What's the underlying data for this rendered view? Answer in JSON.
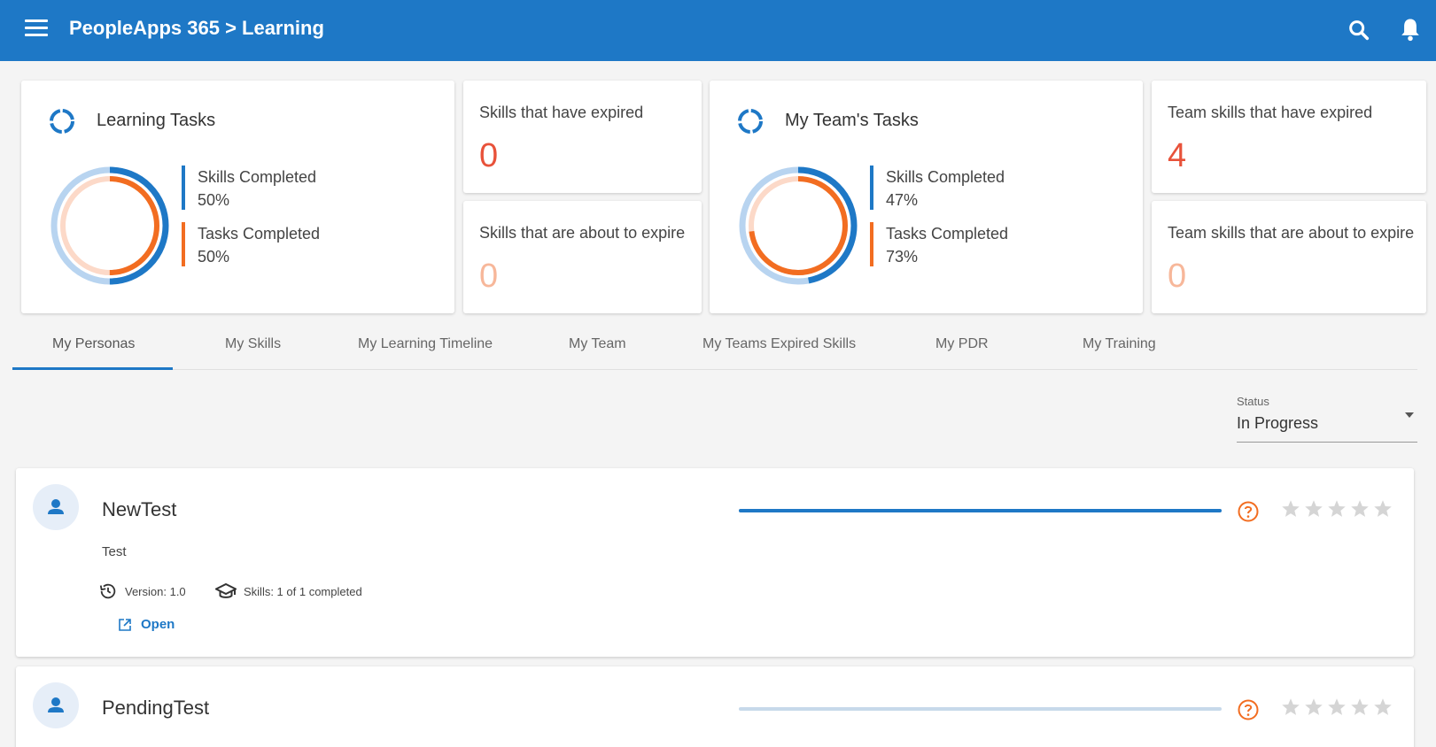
{
  "header": {
    "title": "PeopleApps 365 > Learning"
  },
  "learning_tasks": {
    "title": "Learning Tasks",
    "skills_label": "Skills Completed",
    "skills_value": "50%",
    "skills_fraction": 0.5,
    "tasks_label": "Tasks Completed",
    "tasks_value": "50%",
    "tasks_fraction": 0.5
  },
  "skills_expired": {
    "label": "Skills that have expired",
    "value": "0"
  },
  "skills_about_to_expire": {
    "label": "Skills that are about to expire",
    "value": "0"
  },
  "team_tasks": {
    "title": "My Team's Tasks",
    "skills_label": "Skills Completed",
    "skills_value": "47%",
    "skills_fraction": 0.47,
    "tasks_label": "Tasks Completed",
    "tasks_value": "73%",
    "tasks_fraction": 0.73
  },
  "team_skills_expired": {
    "label": "Team skills that have expired",
    "value": "4"
  },
  "team_skills_about_to_expire": {
    "label": "Team skills that are about to expire",
    "value": "0"
  },
  "tabs": [
    {
      "label": "My Personas"
    },
    {
      "label": "My Skills"
    },
    {
      "label": "My Learning Timeline"
    },
    {
      "label": "My Team"
    },
    {
      "label": "My Teams Expired Skills"
    },
    {
      "label": "My PDR"
    },
    {
      "label": "My Training"
    }
  ],
  "status_filter": {
    "label": "Status",
    "value": "In Progress"
  },
  "personas": [
    {
      "name": "NewTest",
      "description": "Test",
      "version": "Version: 1.0",
      "skills": "Skills: 1 of 1 completed",
      "open_label": "Open",
      "progress": 1.0,
      "rating": 0
    },
    {
      "name": "PendingTest",
      "progress": 0.0,
      "rating": 0
    }
  ],
  "colors": {
    "primary": "#1e78c6",
    "accent_orange": "#f26d21",
    "expired_red": "#e8523a",
    "faded_orange": "#f7b79a",
    "light_blue": "#b8d4f0",
    "light_orange": "#fcd9c8"
  },
  "icons": {
    "menu": "menu-icon",
    "search": "search-icon",
    "bell": "bell-icon",
    "loader": "loader-icon",
    "avatar": "person-icon",
    "history": "history-icon",
    "skills": "graduation-cap-icon",
    "open": "external-link-icon",
    "help": "help-circle-icon",
    "star": "star-icon"
  }
}
